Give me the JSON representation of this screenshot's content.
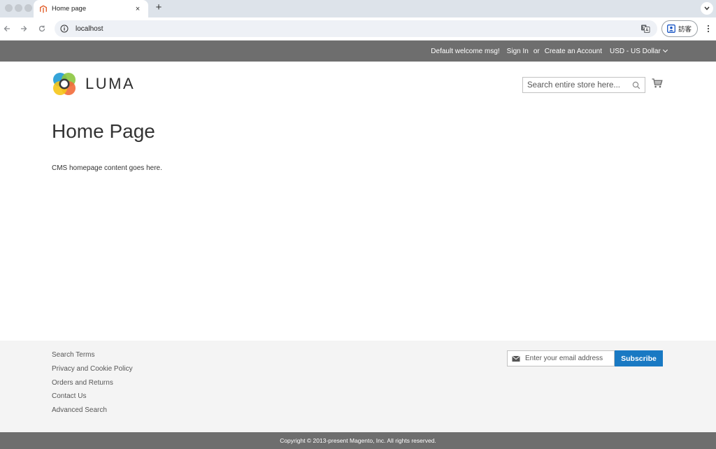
{
  "browser": {
    "tab": {
      "title": "Home page",
      "favicon": "magento-icon",
      "close": "×"
    },
    "new_tab": "+",
    "address": {
      "url": "localhost"
    },
    "profile": {
      "label": "訪客"
    }
  },
  "header": {
    "welcome": "Default welcome msg!",
    "sign_in": "Sign In",
    "or": "or",
    "create_account": "Create an Account",
    "currency": "USD - US Dollar"
  },
  "logo": {
    "text": "LUMA"
  },
  "search": {
    "placeholder": "Search entire store here..."
  },
  "main": {
    "title": "Home Page",
    "content": "CMS homepage content goes here."
  },
  "footer": {
    "links": [
      "Search Terms",
      "Privacy and Cookie Policy",
      "Orders and Returns",
      "Contact Us",
      "Advanced Search"
    ],
    "newsletter": {
      "placeholder": "Enter your email address",
      "button": "Subscribe"
    },
    "copyright": "Copyright © 2013-present Magento, Inc. All rights reserved."
  },
  "colors": {
    "header_bg": "#6e6e6e",
    "footer_bg": "#f4f4f4",
    "subscribe_bg": "#1979c3"
  }
}
